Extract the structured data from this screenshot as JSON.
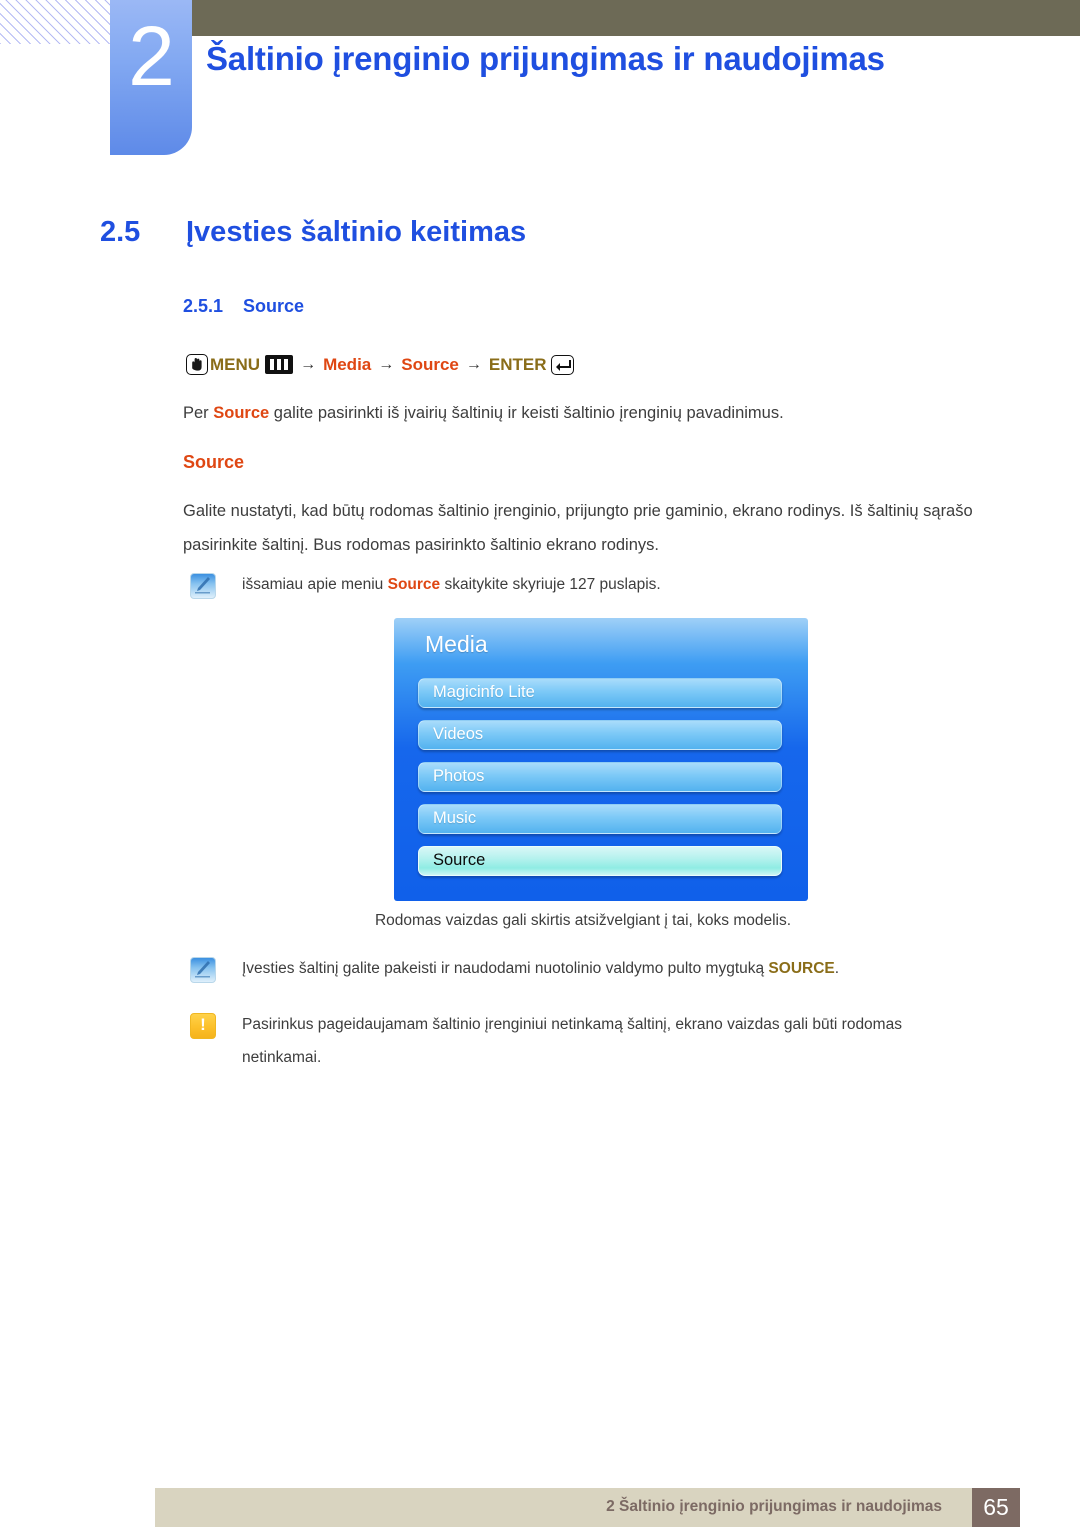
{
  "header": {
    "chapter_number": "2",
    "chapter_title": "Šaltinio įrenginio prijungimas ir naudojimas"
  },
  "section": {
    "h1_number": "2.5",
    "h1_title": "Įvesties šaltinio keitimas",
    "h2_number": "2.5.1",
    "h2_title": "Source"
  },
  "path": {
    "menu_label": "MENU",
    "step_media": "Media",
    "step_source": "Source",
    "enter_label": "ENTER",
    "arrow": "→",
    "hand_icon": "hand-press-icon",
    "menu_icon": "menu-bars-icon",
    "enter_icon": "enter-key-icon"
  },
  "content": {
    "intro_prefix": "Per ",
    "intro_highlight": "Source",
    "intro_suffix": " galite pasirinkti iš įvairių šaltinių ir keisti šaltinio įrenginių pavadinimus.",
    "sub_head": "Source",
    "body_paragraph": "Galite nustatyti, kad būtų rodomas šaltinio įrenginio, prijungto prie gaminio, ekrano rodinys. Iš šaltinių sąrašo pasirinkite šaltinį. Bus rodomas pasirinkto šaltinio ekrano rodinys.",
    "caption": "Rodomas vaizdas gali skirtis atsižvelgiant į tai, koks modelis."
  },
  "notes": [
    {
      "icon": "note-pen-icon",
      "prefix": "išsamiau apie meniu ",
      "highlight": "Source",
      "highlight_color": "orange",
      "suffix": " skaitykite skyriuje 127 puslapis."
    },
    {
      "icon": "note-pen-icon",
      "prefix": "Įvesties šaltinį galite pakeisti ir naudodami nuotolinio valdymo pulto mygtuką ",
      "highlight": "SOURCE",
      "highlight_color": "olive",
      "suffix": "."
    },
    {
      "icon": "warning-exclamation-icon",
      "prefix": "Pasirinkus pageidaujamam šaltinio įrenginiui netinkamą šaltinį, ekrano vaizdas gali būti rodomas netinkamai.",
      "highlight": "",
      "highlight_color": "",
      "suffix": ""
    }
  ],
  "osd": {
    "title": "Media",
    "items": [
      {
        "label": "Magicinfo Lite",
        "selected": false
      },
      {
        "label": "Videos",
        "selected": false
      },
      {
        "label": "Photos",
        "selected": false
      },
      {
        "label": "Music",
        "selected": false
      },
      {
        "label": "Source",
        "selected": true
      }
    ]
  },
  "footer": {
    "text": "2 Šaltinio įrenginio prijungimas ir naudojimas",
    "page_number": "65"
  },
  "colors": {
    "heading_blue": "#1f4fe0",
    "accent_orange": "#df4713",
    "accent_olive": "#8a6d19",
    "olive_bar": "#6d6a56",
    "footer_bg": "#d9d4c0",
    "footer_page_bg": "#7d6a63",
    "osd_blue": "#1667ec",
    "osd_selected": "#b6f2ee"
  }
}
